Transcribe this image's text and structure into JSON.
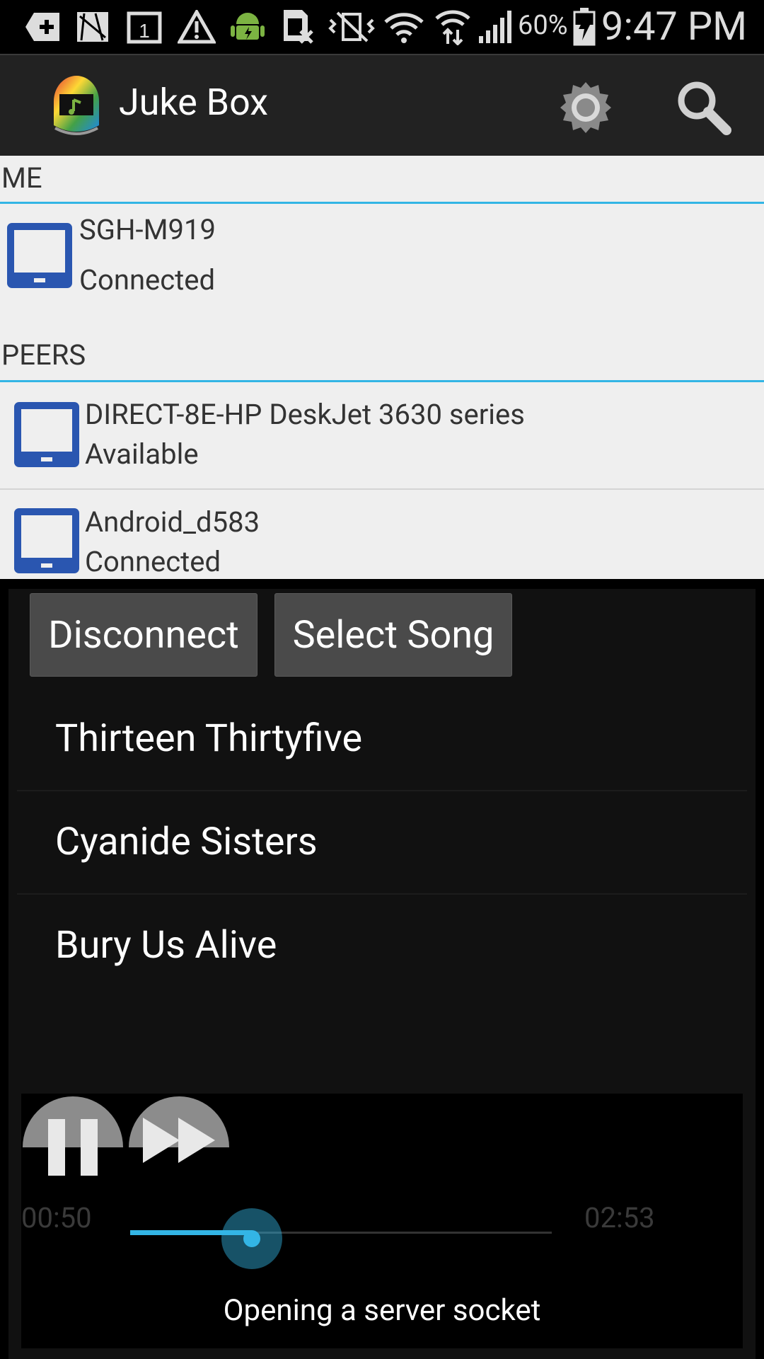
{
  "status_bar": {
    "battery_percent": "60%",
    "time": "9:47 PM",
    "icons": [
      "plus-icon",
      "sim-card-icon",
      "calendar-1-icon",
      "warning-icon",
      "android-icon",
      "sim-card-x-icon",
      "vibrate-icon",
      "wifi-icon",
      "wifi-transfer-icon",
      "signal-icon",
      "battery-charging-icon"
    ]
  },
  "action_bar": {
    "title": "Juke Box",
    "icons": [
      "app-logo-icon",
      "settings-gear-icon",
      "search-icon"
    ]
  },
  "me_section": {
    "header": "ME",
    "device": {
      "name": "SGH-M919",
      "status": "Connected"
    }
  },
  "peers_section": {
    "header": "PEERS",
    "devices": [
      {
        "name": "DIRECT-8E-HP DeskJet 3630 series",
        "status": "Available"
      },
      {
        "name": "Android_d583",
        "status": "Connected"
      }
    ]
  },
  "buttons": {
    "disconnect": "Disconnect",
    "select_song": "Select Song"
  },
  "songs": [
    "Thirteen Thirtyfive",
    "Cyanide Sisters",
    "Bury Us Alive"
  ],
  "player": {
    "elapsed": "00:50",
    "total": "02:53",
    "progress_fraction": 0.289,
    "status_message": "Opening a server socket"
  },
  "colors": {
    "accent": "#33b5e5",
    "device_icon": "#2a56b0",
    "actionbar_bg": "#222222",
    "list_bg": "#efefef"
  }
}
